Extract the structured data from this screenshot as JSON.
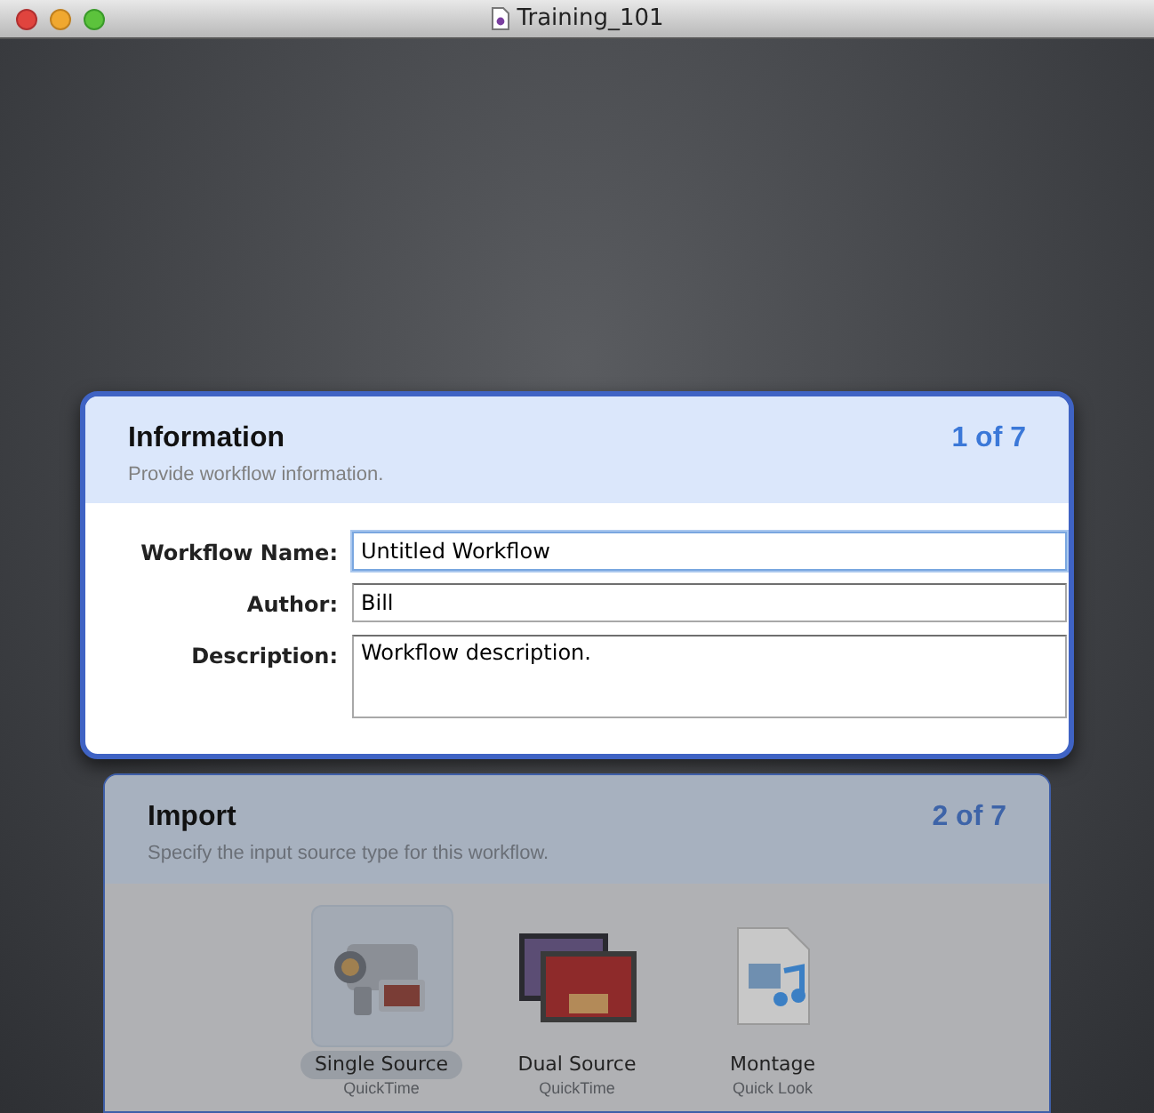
{
  "window": {
    "title": "Training_101"
  },
  "steps": [
    {
      "title": "Information",
      "subtitle": "Provide workflow information.",
      "counter": "1 of 7",
      "active": true,
      "fields": [
        {
          "label": "Workflow Name:",
          "value": "Untitled Workflow",
          "kind": "input",
          "focused": true
        },
        {
          "label": "Author:",
          "value": "Bill",
          "kind": "input",
          "focused": false
        },
        {
          "label": "Description:",
          "value": "Workflow description.",
          "kind": "textarea",
          "focused": false
        }
      ]
    },
    {
      "title": "Import",
      "subtitle": "Specify the input source type for this workflow.",
      "counter": "2 of 7",
      "active": false,
      "options": [
        {
          "kind": "camera",
          "label": "Single Source",
          "sublabel": "QuickTime",
          "selected": true
        },
        {
          "kind": "screens",
          "label": "Dual Source",
          "sublabel": "QuickTime",
          "selected": false
        },
        {
          "kind": "document",
          "label": "Montage",
          "sublabel": "Quick Look",
          "selected": false
        }
      ]
    }
  ]
}
